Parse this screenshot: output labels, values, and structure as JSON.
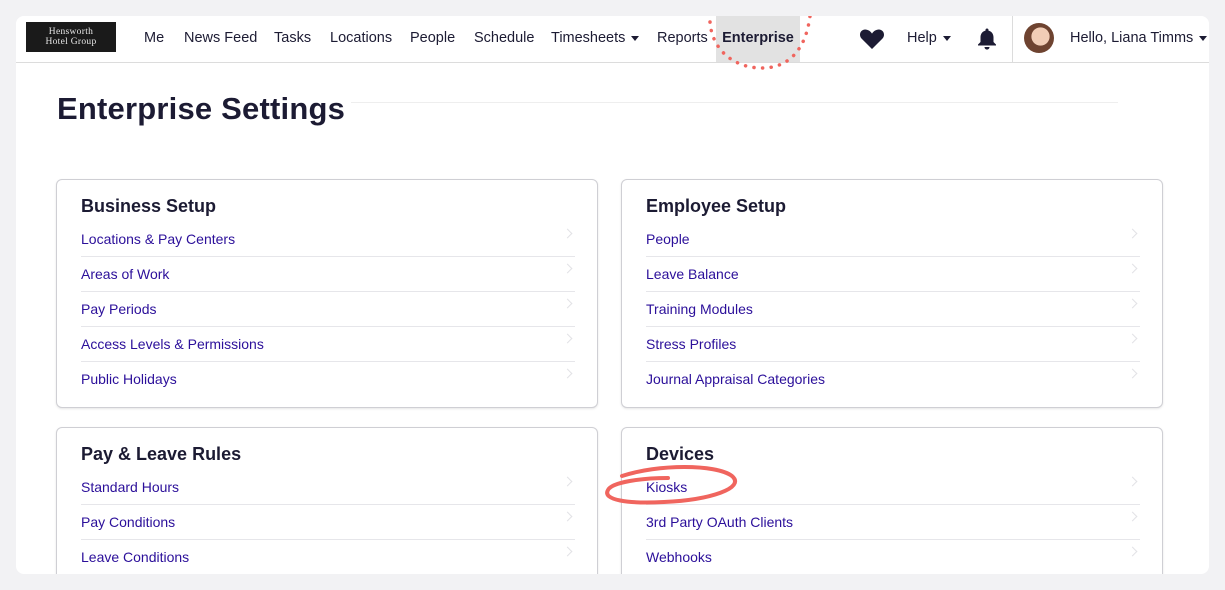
{
  "brand": {
    "line1": "Hensworth",
    "line2": "Hotel Group"
  },
  "nav": {
    "items": [
      "Me",
      "News Feed",
      "Tasks",
      "Locations",
      "People",
      "Schedule",
      "Timesheets",
      "Reports",
      "Enterprise"
    ],
    "active": "Enterprise",
    "help_label": "Help",
    "greeting": "Hello, Liana Timms"
  },
  "page": {
    "title": "Enterprise Settings"
  },
  "cards": [
    {
      "title": "Business Setup",
      "items": [
        "Locations & Pay Centers",
        "Areas of Work",
        "Pay Periods",
        "Access Levels & Permissions",
        "Public Holidays"
      ]
    },
    {
      "title": "Employee Setup",
      "items": [
        "People",
        "Leave Balance",
        "Training Modules",
        "Stress Profiles",
        "Journal Appraisal Categories"
      ]
    },
    {
      "title": "Pay & Leave Rules",
      "items": [
        "Standard Hours",
        "Pay Conditions",
        "Leave Conditions"
      ]
    },
    {
      "title": "Devices",
      "items": [
        "Kiosks",
        "3rd Party OAuth Clients",
        "Webhooks"
      ]
    }
  ],
  "colors": {
    "link": "#2b0f9a",
    "text": "#1c1b33",
    "annotation": "#f0655e",
    "active_tab_bg": "#e2e2e2"
  },
  "icons": [
    "heart-icon",
    "bell-icon",
    "caret-down-icon",
    "chevron-right-icon"
  ]
}
